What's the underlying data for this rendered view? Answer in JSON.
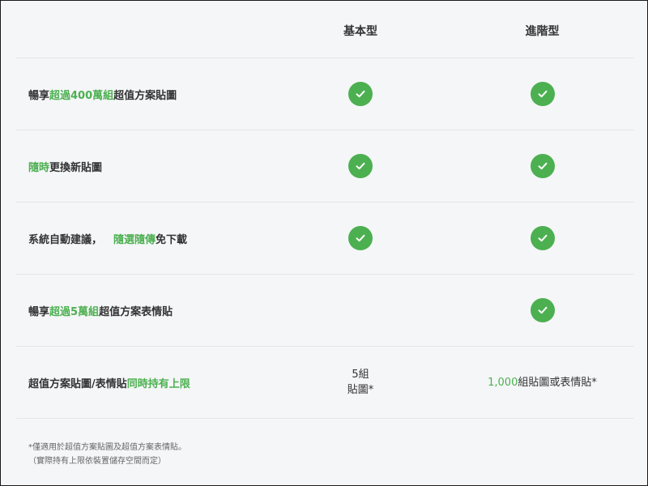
{
  "header": {
    "basic": "基本型",
    "advanced": "進階型"
  },
  "rows": [
    {
      "feature": {
        "pre": "暢享",
        "hl": "超過400萬組",
        "post": "超值方案貼圖"
      },
      "basic": true,
      "advanced": true
    },
    {
      "feature": {
        "hl": "隨時",
        "post": "更換新貼圖"
      },
      "basic": true,
      "advanced": true
    },
    {
      "feature": {
        "pre": "系統自動建議，",
        "hl": "隨選隨傳",
        "post": "免下載"
      },
      "basic": true,
      "advanced": true
    },
    {
      "feature": {
        "pre": "暢享",
        "hl": "超過5萬組",
        "post": "超值方案表情貼"
      },
      "basic": false,
      "advanced": true
    },
    {
      "feature": {
        "pre": "超值方案貼圖/表情貼",
        "hl": "同時持有上限"
      },
      "basic_text": {
        "line1": "5組",
        "line2": "貼圖*"
      },
      "advanced_text": {
        "hl": "1,000",
        "post": "組貼圖或表情貼*"
      }
    }
  ],
  "footnote": {
    "line1": "*僅適用於超值方案貼圖及超值方案表情貼。",
    "line2": "（實際持有上限依裝置儲存空間而定）"
  },
  "colors": {
    "accent": "#4cb050",
    "text": "#333333",
    "background": "#f5f6f8",
    "divider": "#e3e5e8"
  },
  "icons": {
    "included": "check-circle-icon"
  }
}
